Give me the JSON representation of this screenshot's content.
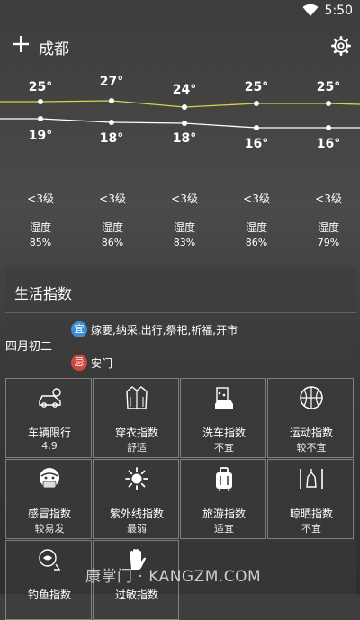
{
  "status": {
    "time": "5:50"
  },
  "header": {
    "city": "成都"
  },
  "forecast": {
    "highs": [
      "25°",
      "27°",
      "24°",
      "25°",
      "25°"
    ],
    "lows": [
      "19°",
      "18°",
      "18°",
      "16°",
      "16°"
    ],
    "wind": [
      "<3级",
      "<3级",
      "<3级",
      "<3级",
      "<3级"
    ],
    "humidity_label": "湿度",
    "humidity": [
      "85%",
      "86%",
      "83%",
      "86%",
      "79%"
    ]
  },
  "life": {
    "title": "生活指数",
    "lunar_date": "四月初二",
    "yi_badge": "宜",
    "yi_text": "嫁要,纳采,出行,祭祀,祈福,开市",
    "ji_badge": "忌",
    "ji_text": "安门",
    "items": [
      {
        "name": "车辆限行",
        "value": "4,9",
        "icon": "car-icon"
      },
      {
        "name": "穿衣指数",
        "value": "舒适",
        "icon": "coat-icon"
      },
      {
        "name": "洗车指数",
        "value": "不宜",
        "icon": "car-wash-icon"
      },
      {
        "name": "运动指数",
        "value": "较不宜",
        "icon": "basketball-icon"
      },
      {
        "name": "感冒指数",
        "value": "较易发",
        "icon": "mask-icon"
      },
      {
        "name": "紫外线指数",
        "value": "最弱",
        "icon": "sun-icon"
      },
      {
        "name": "旅游指数",
        "value": "适宜",
        "icon": "luggage-icon"
      },
      {
        "name": "晾晒指数",
        "value": "不宜",
        "icon": "hanger-icon"
      },
      {
        "name": "钓鱼指数",
        "value": "",
        "icon": "fishing-icon"
      },
      {
        "name": "过敏指数",
        "value": "",
        "icon": "hand-icon"
      }
    ]
  },
  "watermark": "康掌门 · KANGZM.COM",
  "colors": {
    "high_line": "#d9d24a",
    "low_line": "#ffffff",
    "yi": "#3f8fd6",
    "ji": "#d2473f"
  }
}
